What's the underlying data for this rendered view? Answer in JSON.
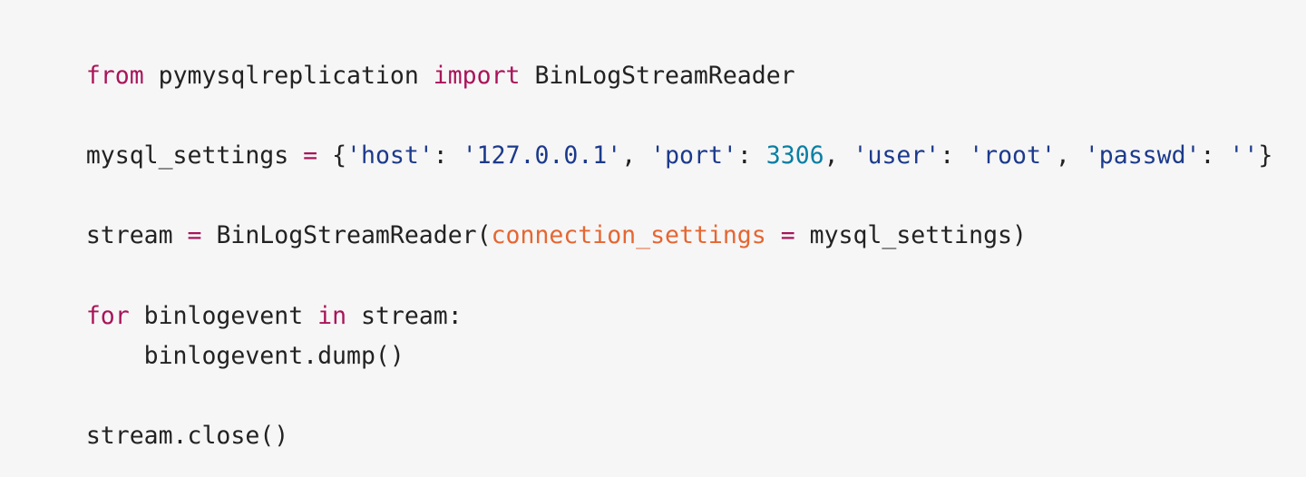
{
  "code": {
    "language": "python",
    "lines": [
      [
        {
          "t": "from",
          "k": "kw"
        },
        {
          "t": " pymysqlreplication ",
          "k": "plain"
        },
        {
          "t": "import",
          "k": "kw"
        },
        {
          "t": " BinLogStreamReader",
          "k": "plain"
        }
      ],
      [
        {
          "t": "mysql_settings ",
          "k": "plain"
        },
        {
          "t": "=",
          "k": "op"
        },
        {
          "t": " {",
          "k": "punct"
        },
        {
          "t": "'host'",
          "k": "str"
        },
        {
          "t": ": ",
          "k": "punct"
        },
        {
          "t": "'127.0.0.1'",
          "k": "str"
        },
        {
          "t": ", ",
          "k": "punct"
        },
        {
          "t": "'port'",
          "k": "str"
        },
        {
          "t": ": ",
          "k": "punct"
        },
        {
          "t": "3306",
          "k": "num"
        },
        {
          "t": ", ",
          "k": "punct"
        },
        {
          "t": "'user'",
          "k": "str"
        },
        {
          "t": ": ",
          "k": "punct"
        },
        {
          "t": "'root'",
          "k": "str"
        },
        {
          "t": ", ",
          "k": "punct"
        },
        {
          "t": "'passwd'",
          "k": "str"
        },
        {
          "t": ": ",
          "k": "punct"
        },
        {
          "t": "''",
          "k": "str"
        },
        {
          "t": "}",
          "k": "punct"
        }
      ],
      [
        {
          "t": "stream ",
          "k": "plain"
        },
        {
          "t": "=",
          "k": "op"
        },
        {
          "t": " BinLogStreamReader(",
          "k": "plain"
        },
        {
          "t": "connection_settings",
          "k": "param"
        },
        {
          "t": " ",
          "k": "plain"
        },
        {
          "t": "=",
          "k": "op"
        },
        {
          "t": " mysql_settings)",
          "k": "plain"
        }
      ],
      [
        {
          "t": "for",
          "k": "kw"
        },
        {
          "t": " binlogevent ",
          "k": "plain"
        },
        {
          "t": "in",
          "k": "kw"
        },
        {
          "t": " stream:",
          "k": "plain"
        }
      ],
      [
        {
          "t": "    binlogevent.dump()",
          "k": "plain"
        }
      ],
      [
        {
          "t": "stream.close()",
          "k": "plain"
        }
      ]
    ]
  },
  "colors": {
    "background": "#f6f6f6",
    "keyword": "#a9145a",
    "string": "#1c3a8c",
    "number": "#0a7fa4",
    "parameter": "#e56632",
    "text": "#222222"
  }
}
